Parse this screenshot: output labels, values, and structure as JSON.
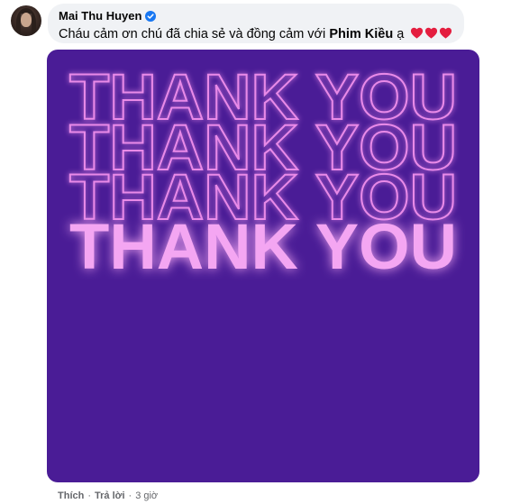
{
  "comment": {
    "author": "Mai Thu Huyen",
    "text_before": "Cháu cảm ơn chú đã chia sẻ và đồng cảm với ",
    "mention": "Phim Kiều",
    "text_after": " ạ",
    "reaction_emojis": [
      "red-heart",
      "red-heart",
      "red-heart"
    ]
  },
  "sticker": {
    "lines": [
      "THANK YOU",
      "THANK YOU",
      "THANK YOU",
      "THANK YOU"
    ],
    "background_color": "#4a1c96",
    "text_color": "#f4a6f2"
  },
  "actions": {
    "like": "Thích",
    "reply": "Trả lời",
    "separator": "·",
    "time": "3 giờ"
  },
  "colors": {
    "bubble": "#f0f2f5",
    "verified": "#1877f2",
    "heart": "#e41e3f",
    "meta_text": "#65676b"
  }
}
